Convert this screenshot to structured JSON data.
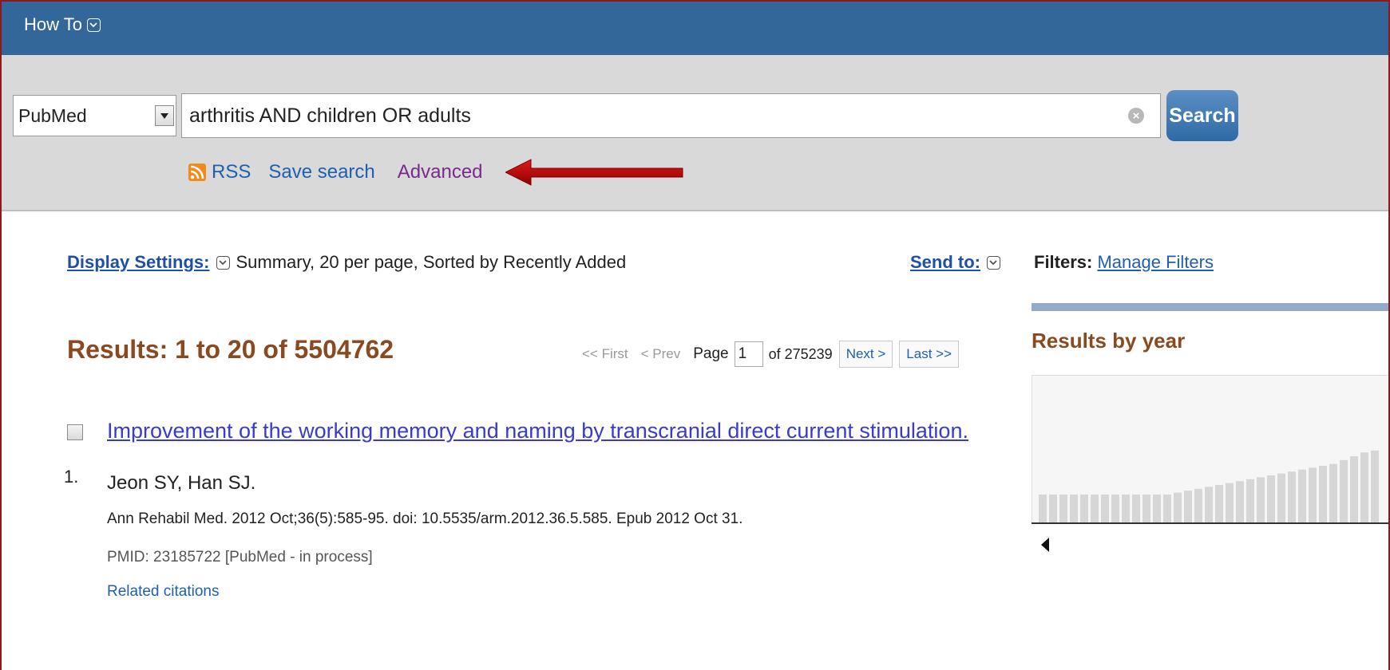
{
  "header": {
    "howto_label": "How To"
  },
  "search": {
    "database": "PubMed",
    "query": "arthritis AND children OR adults",
    "button_label": "Search",
    "links": {
      "rss": "RSS",
      "save_search": "Save search",
      "advanced": "Advanced"
    }
  },
  "display": {
    "settings_label": "Display Settings:",
    "settings_value": "Summary, 20 per page, Sorted by Recently Added",
    "send_to_label": "Send to:"
  },
  "filters": {
    "label": "Filters:",
    "manage_link": "Manage Filters"
  },
  "results": {
    "title": "Results: 1 to 20 of 5504762",
    "pager": {
      "first": "<< First",
      "prev": "< Prev",
      "page_label": "Page",
      "page_value": "1",
      "of_label": "of 275239",
      "next": "Next >",
      "last": "Last >>"
    },
    "items": [
      {
        "number": "1.",
        "title": "Improvement of the working memory and naming by transcranial direct current stimulation.",
        "authors": "Jeon SY, Han SJ.",
        "journal": "Ann Rehabil Med. 2012 Oct;36(5):585-95. doi: 10.5535/arm.2012.36.5.585. Epub 2012 Oct 31.",
        "pmid": "PMID: 23185722 [PubMed - in process]",
        "related": "Related citations"
      }
    ]
  },
  "sidebar": {
    "results_by_year_title": "Results by year"
  },
  "year_chart_relative_heights": [
    0.15,
    0.15,
    0.15,
    0.15,
    0.15,
    0.15,
    0.15,
    0.15,
    0.15,
    0.15,
    0.15,
    0.15,
    0.15,
    0.16,
    0.17,
    0.18,
    0.19,
    0.2,
    0.21,
    0.22,
    0.23,
    0.24,
    0.25,
    0.26,
    0.27,
    0.28,
    0.29,
    0.3,
    0.31,
    0.33,
    0.35,
    0.37,
    0.38
  ],
  "colors": {
    "topbar": "#336699",
    "search_band": "#d9d9d9",
    "results_title": "#8a4a21",
    "link": "#1f5fb0",
    "visited_link": "#7b2a8c",
    "arrow": "#c00000"
  }
}
